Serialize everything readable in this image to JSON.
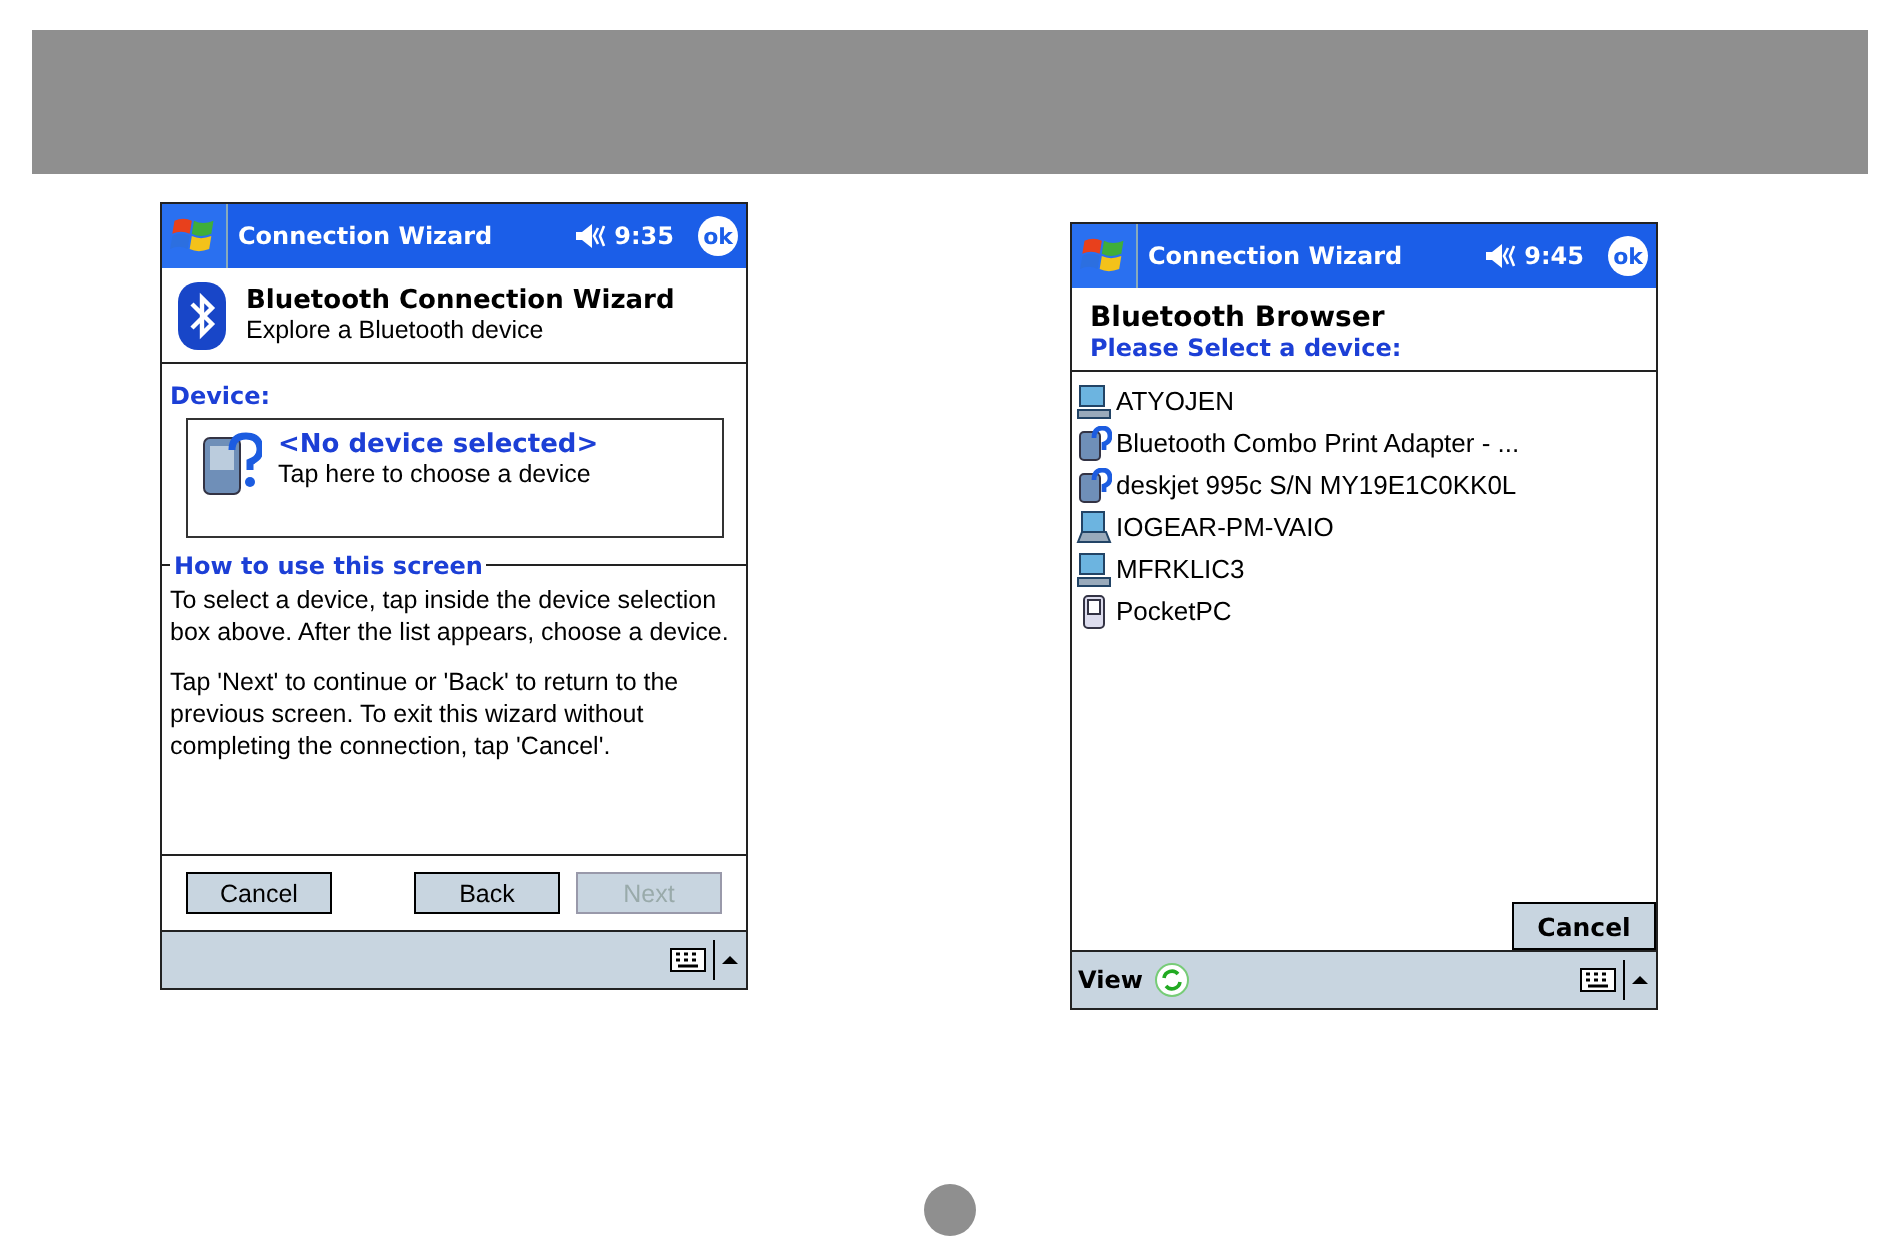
{
  "left_screen": {
    "title_bar": {
      "title": "Connection Wizard",
      "time": "9:35",
      "ok": "ok"
    },
    "header": {
      "title": "Bluetooth Connection Wizard",
      "subtitle": "Explore a Bluetooth device"
    },
    "device": {
      "label": "Device:",
      "value": "<No device selected>",
      "hint": "Tap here to choose a device"
    },
    "help": {
      "heading": "How to use this screen",
      "paragraphs": [
        "To select a device, tap inside the device selection box above. After the list appears, choose a device.",
        "Tap 'Next' to continue or 'Back' to return to the previous screen. To exit this wizard without completing the connection, tap 'Cancel'."
      ]
    },
    "buttons": [
      {
        "label": "Cancel",
        "disabled": false
      },
      {
        "label": "Back",
        "disabled": false
      },
      {
        "label": "Next",
        "disabled": true
      }
    ]
  },
  "right_screen": {
    "title_bar": {
      "title": "Connection Wizard",
      "time": "9:45",
      "ok": "ok"
    },
    "header": {
      "title": "Bluetooth Browser",
      "subtitle": "Please Select a device:"
    },
    "devices": [
      {
        "name": "ATYOJEN",
        "kind": "computer"
      },
      {
        "name": "Bluetooth Combo Print Adapter - ...",
        "kind": "unknown"
      },
      {
        "name": "deskjet 995c S/N MY19E1C0KK0L",
        "kind": "unknown"
      },
      {
        "name": "IOGEAR-PM-VAIO",
        "kind": "laptop"
      },
      {
        "name": "MFRKLIC3",
        "kind": "computer"
      },
      {
        "name": "PocketPC",
        "kind": "pda"
      }
    ],
    "cancel": "Cancel",
    "menu": "View"
  }
}
